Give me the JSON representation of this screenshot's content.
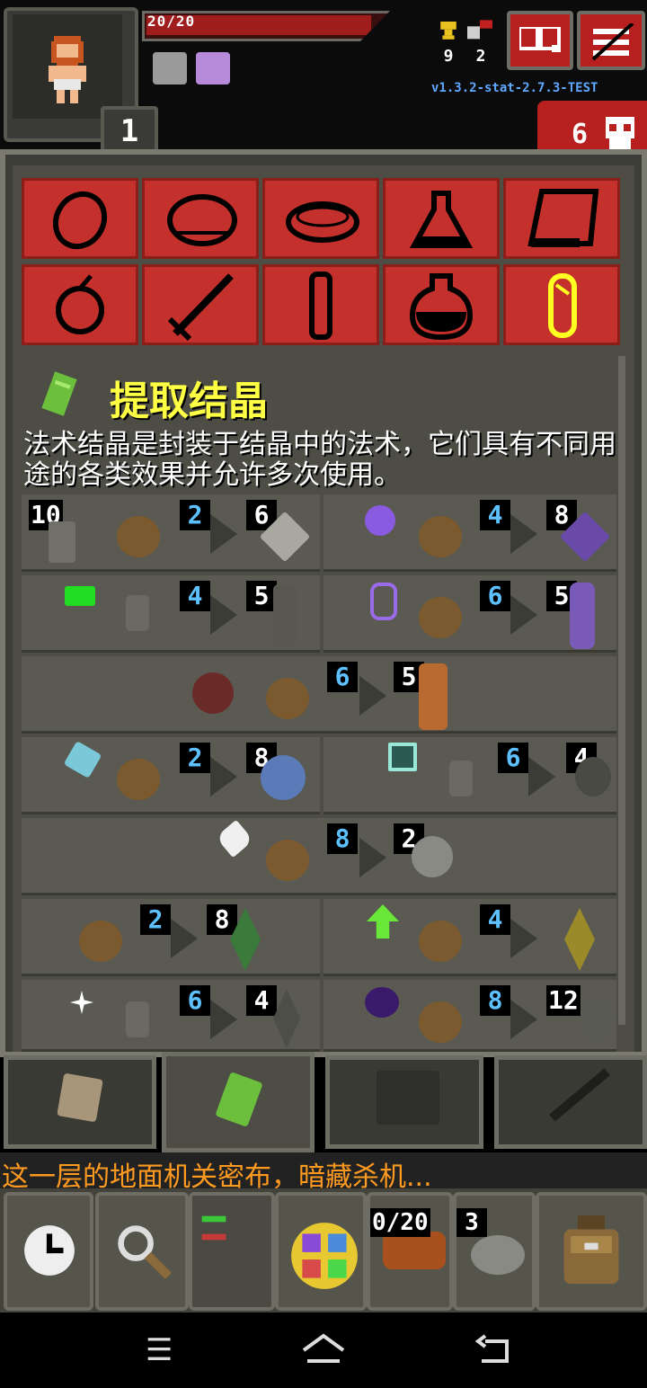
{
  "hud": {
    "hp_text": "20/20",
    "level": "1",
    "stat_gold": "9",
    "stat_keys": "2",
    "version": "v1.3.2-stat-2.7.3-TEST",
    "danger_count": "6",
    "icons": [
      "trophy-icon",
      "key-icon",
      "journal-icon",
      "menu-icon",
      "skull-icon"
    ]
  },
  "window": {
    "title": "提取结晶",
    "description": "法术结晶是封装于结晶中的法术，它们具有不同用途的各类效果并允许多次使用。",
    "categories": [
      "seed",
      "stone",
      "plank",
      "potion",
      "scroll",
      "fruit",
      "wand",
      "stick",
      "flask",
      "crystal"
    ],
    "recipes": [
      {
        "left": {
          "a": "10",
          "b": "2",
          "c": "6"
        },
        "right": {
          "a": "4",
          "b": "8"
        }
      },
      {
        "left": {
          "a": "4",
          "b": "5"
        },
        "right": {
          "a": "6",
          "b": "5"
        }
      },
      {
        "center": {
          "a": "6",
          "b": "5"
        }
      },
      {
        "left": {
          "a": "2",
          "b": "8"
        },
        "right": {
          "a": "6",
          "b": "4"
        }
      },
      {
        "center": {
          "a": "8",
          "b": "2"
        }
      },
      {
        "left": {
          "a": "2",
          "b": "8"
        },
        "right": {
          "a": "4"
        }
      },
      {
        "left": {
          "a": "6",
          "b": "4"
        },
        "right": {
          "a": "8",
          "b": "12"
        }
      }
    ]
  },
  "log": {
    "message": "这一层的地面机关密布，暗藏杀机..."
  },
  "quickbar": {
    "darts": "0/20",
    "stones": "3"
  },
  "colors": {
    "accent_red": "#b82020",
    "title_yellow": "#ffff44",
    "num_blue": "#5ec1ff",
    "log_orange": "#ff9a20"
  }
}
